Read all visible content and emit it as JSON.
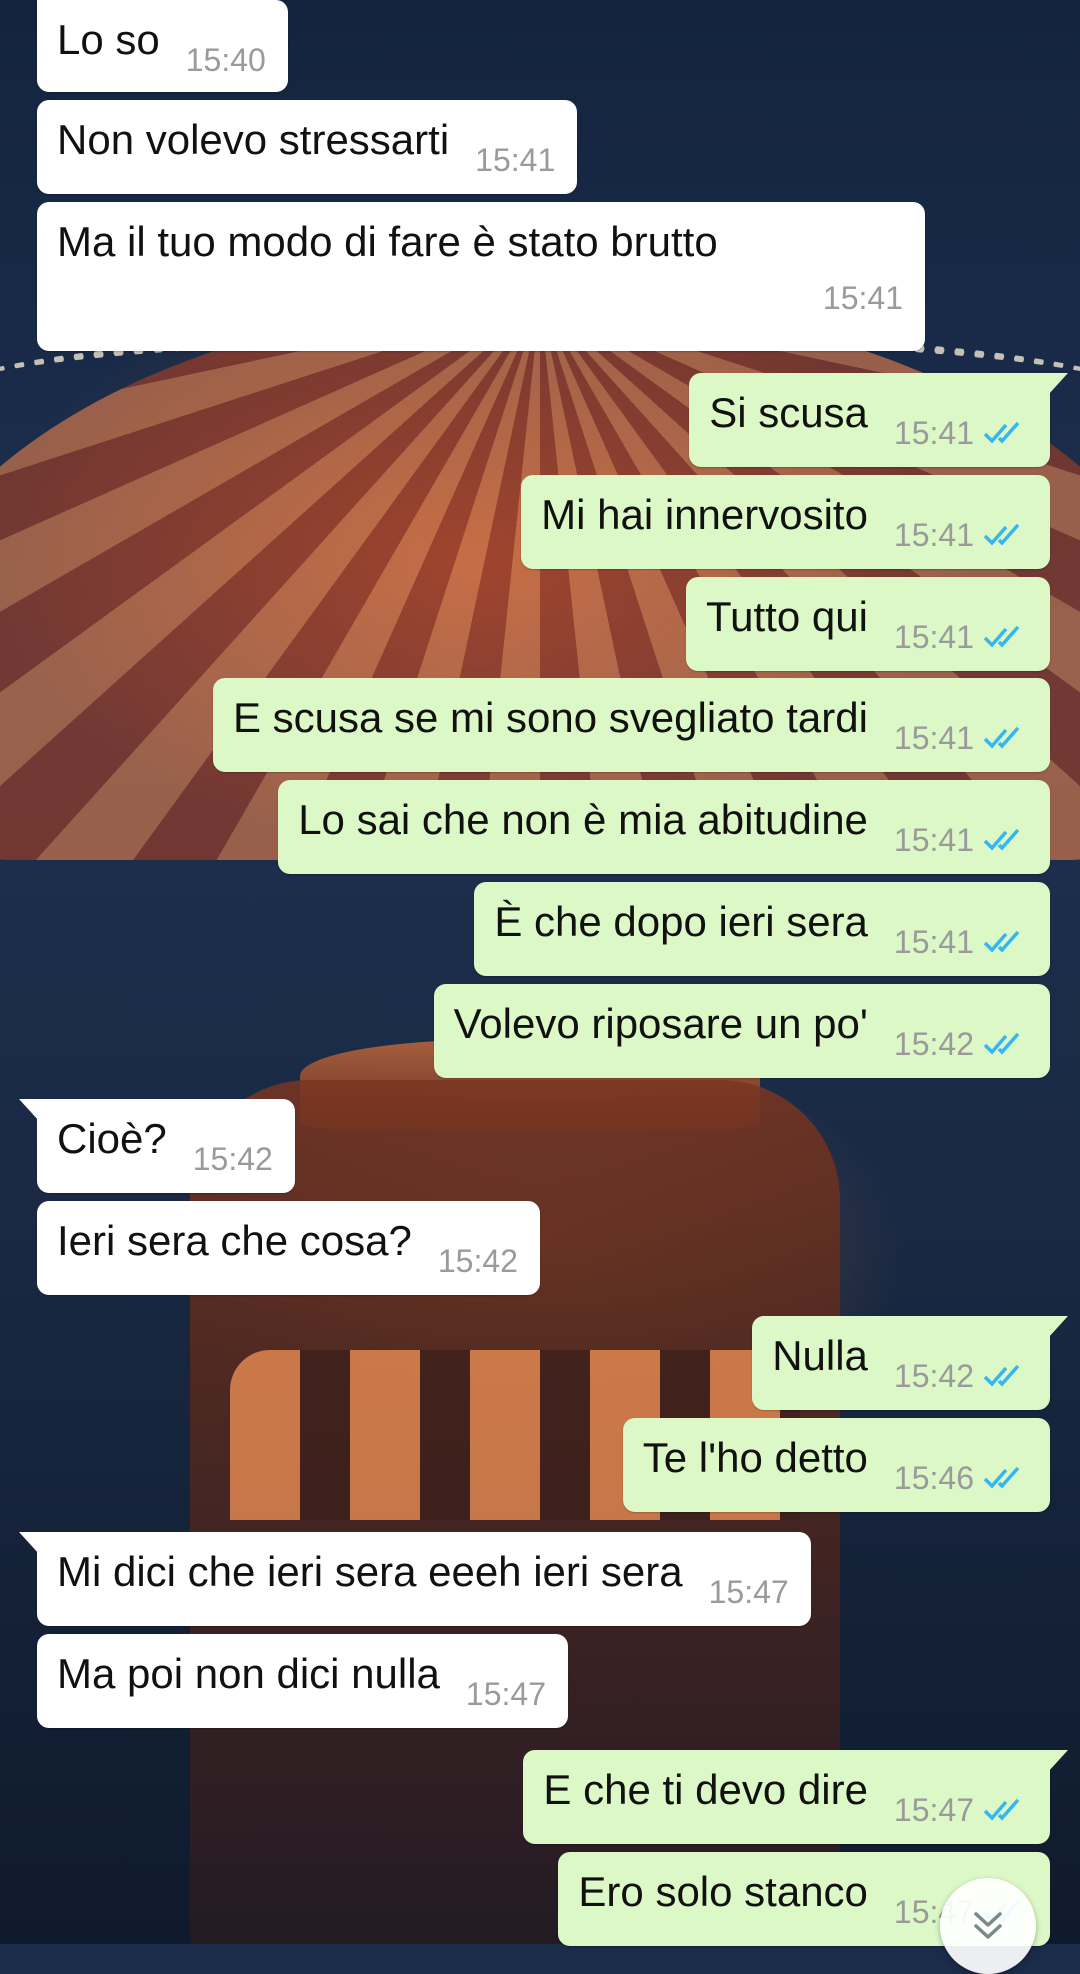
{
  "wallpaper": {
    "description_icon": "carousel-and-tower-wallpaper"
  },
  "colors": {
    "incoming_bubble": "#ffffff",
    "outgoing_bubble": "#dcf8c6",
    "read_ticks": "#34b7f1",
    "timestamp": "#9a9a9a"
  },
  "messages": [
    {
      "dir": "in",
      "text": "Lo so",
      "time": "15:40"
    },
    {
      "dir": "in",
      "text": "Non volevo stressarti",
      "time": "15:41"
    },
    {
      "dir": "in",
      "text": "Ma il tuo modo di fare è stato brutto",
      "time": "15:41"
    },
    {
      "dir": "out",
      "text": "Si scusa",
      "time": "15:41",
      "status": "read"
    },
    {
      "dir": "out",
      "text": "Mi hai innervosito",
      "time": "15:41",
      "status": "read"
    },
    {
      "dir": "out",
      "text": "Tutto qui",
      "time": "15:41",
      "status": "read"
    },
    {
      "dir": "out",
      "text": "E scusa se mi sono svegliato tardi",
      "time": "15:41",
      "status": "read"
    },
    {
      "dir": "out",
      "text": "Lo sai che non è mia abitudine",
      "time": "15:41",
      "status": "read"
    },
    {
      "dir": "out",
      "text": "È che dopo ieri sera",
      "time": "15:41",
      "status": "read"
    },
    {
      "dir": "out",
      "text": "Volevo riposare un po'",
      "time": "15:42",
      "status": "read"
    },
    {
      "dir": "in",
      "text": "Cioè?",
      "time": "15:42"
    },
    {
      "dir": "in",
      "text": "Ieri sera che cosa?",
      "time": "15:42"
    },
    {
      "dir": "out",
      "text": "Nulla",
      "time": "15:42",
      "status": "read"
    },
    {
      "dir": "out",
      "text": "Te l'ho detto",
      "time": "15:46",
      "status": "read"
    },
    {
      "dir": "in",
      "text": "Mi dici che ieri sera eeeh ieri sera",
      "time": "15:47"
    },
    {
      "dir": "in",
      "text": "Ma poi non dici nulla",
      "time": "15:47"
    },
    {
      "dir": "out",
      "text": "E che ti devo dire",
      "time": "15:47",
      "status": "read"
    },
    {
      "dir": "out",
      "text": "Ero solo stanco",
      "time": "15:47",
      "status": "read"
    }
  ],
  "scroll_button": {
    "icon": "double-chevron-down-icon"
  }
}
